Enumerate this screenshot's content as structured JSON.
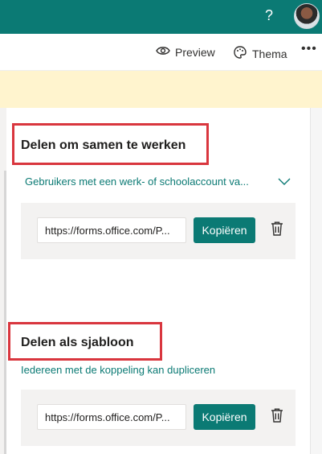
{
  "header": {
    "help_label": "?",
    "avatar_icon": "user-avatar"
  },
  "toolbar": {
    "preview_label": "Preview",
    "theme_label": "Thema",
    "more_label": "•••"
  },
  "share_collaborate": {
    "title": "Delen om samen te werken",
    "scope": "Gebruikers met een werk- of schoolaccount va...",
    "link": "https://forms.office.com/P...",
    "copy_label": "Kopiëren"
  },
  "share_template": {
    "title": "Delen als sjabloon",
    "scope": "Iedereen met de koppeling kan dupliceren",
    "link": "https://forms.office.com/P...",
    "copy_label": "Kopiëren"
  },
  "colors": {
    "accent": "#0b7a74",
    "banner": "#fff4ce",
    "highlight": "#d9363e"
  }
}
